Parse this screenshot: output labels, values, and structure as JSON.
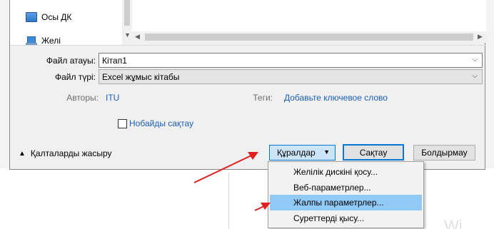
{
  "nav": {
    "items": [
      {
        "label": "Осы ДК",
        "icon": "computer-icon"
      },
      {
        "label": "Желі",
        "icon": "network-icon"
      }
    ]
  },
  "form": {
    "filename_label": "Файл атауы:",
    "filename_value": "Кітап1",
    "filetype_label": "Файл түрі:",
    "filetype_value": "Excel жұмыс кітабы",
    "authors_label": "Авторы:",
    "authors_value": "ITU",
    "tags_label": "Теги:",
    "tags_value": "Добавьте ключевое слово",
    "thumbnail_label": "Нобайды сақтау"
  },
  "footer": {
    "hide_folders_label": "Қалталарды жасыру",
    "tools_label": "Құралдар",
    "save_label": "Сақтау",
    "cancel_label": "Болдырмау"
  },
  "tools_menu": {
    "items": [
      {
        "label": "Желілік дискіні қосу..."
      },
      {
        "label": "Веб-параметрлер..."
      },
      {
        "label": "Жалпы параметрлер...",
        "highlighted": true
      },
      {
        "label": "Суреттерді қысу..."
      }
    ]
  },
  "background": {
    "watermark_text": "Wi"
  },
  "colors": {
    "accent": "#0078d7",
    "link": "#1a5fb4",
    "menu_highlight": "#91c9f7",
    "annotation_arrow": "#e02020"
  }
}
